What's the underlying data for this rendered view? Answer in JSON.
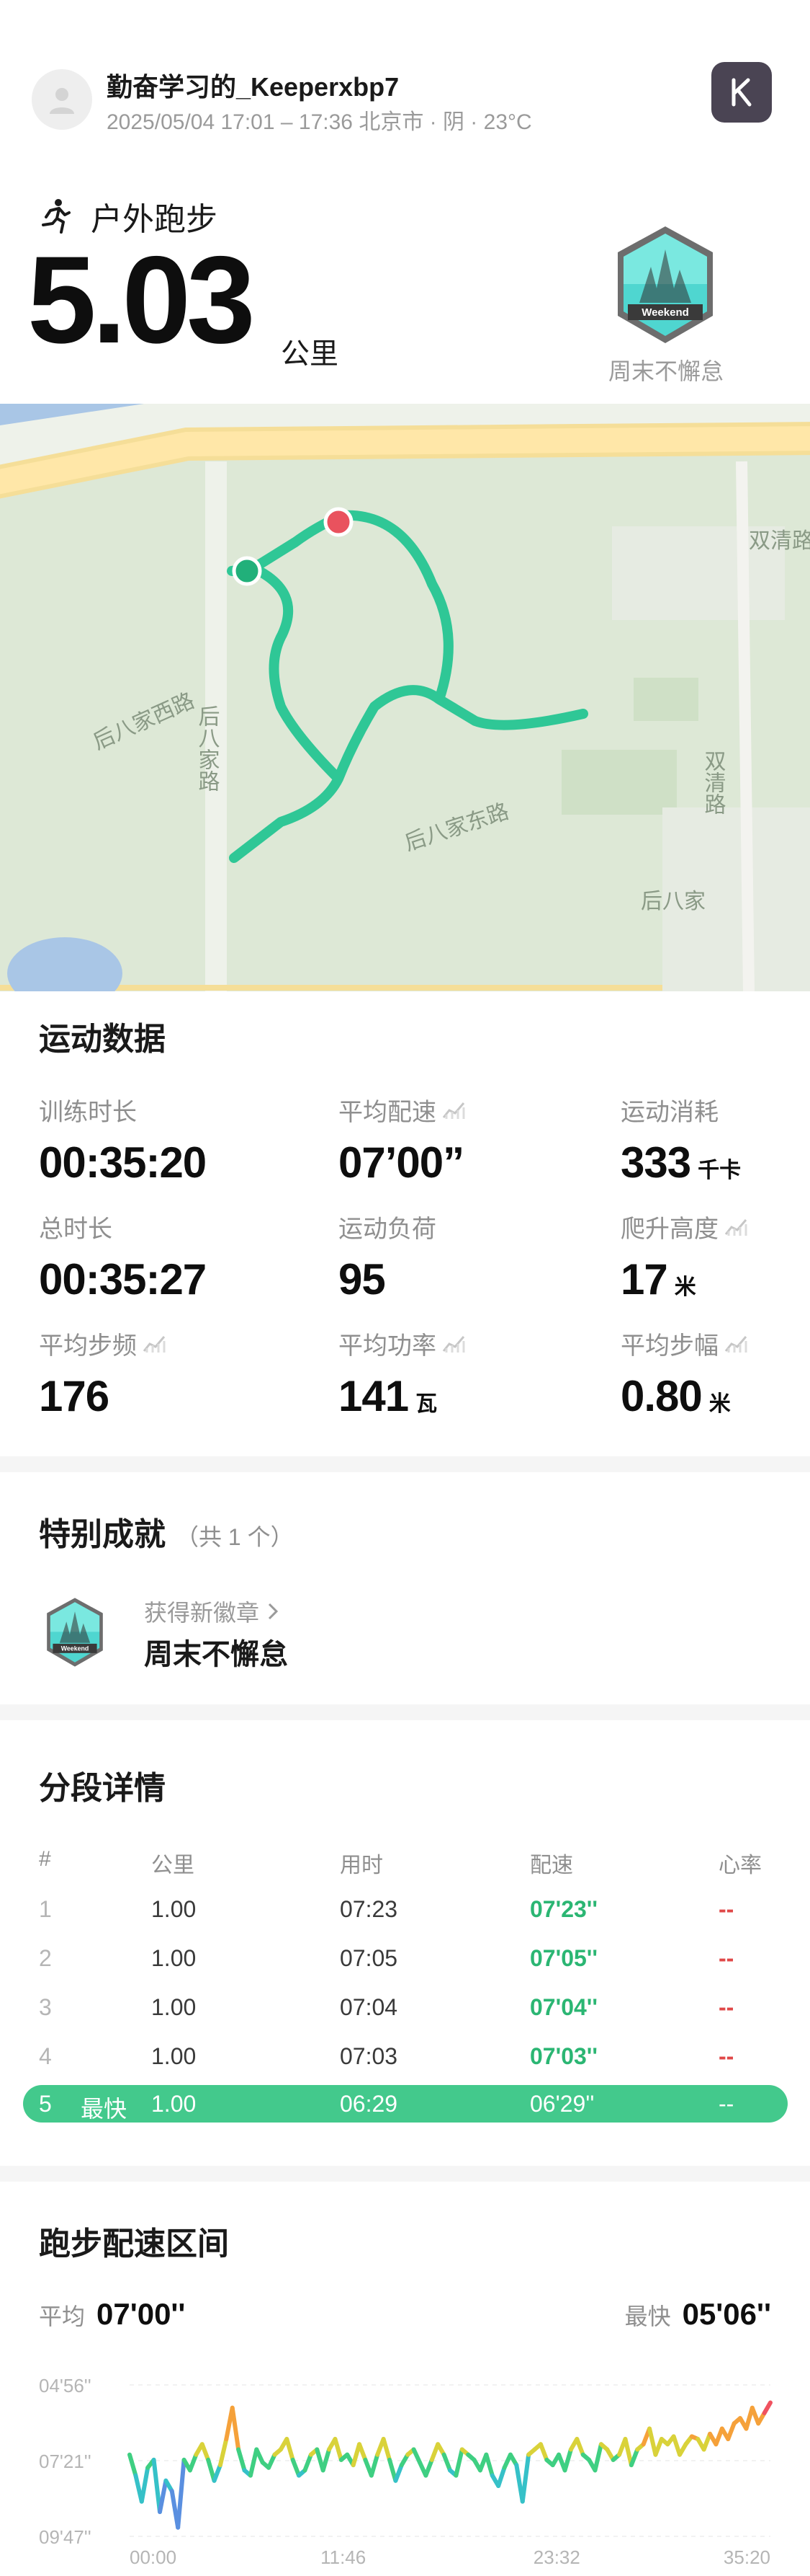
{
  "header": {
    "username": "勤奋学习的_Keeperxbp7",
    "meta": "2025/05/04 17:01 – 17:36 北京市 · 阴 · 23°C",
    "sport": "户外跑步",
    "distance": "5.03",
    "distance_unit": "公里",
    "badge_name": "周末不懈怠",
    "badge_text": "Weekend"
  },
  "map": {
    "labels": [
      "后八家西路",
      "后八家路",
      "后八家东路",
      "双清路",
      "双清路",
      "后八家"
    ]
  },
  "stats": {
    "title": "运动数据",
    "items": [
      {
        "label": "训练时长",
        "value": "00:35:20",
        "unit": ""
      },
      {
        "label": "平均配速",
        "value": "07’00”",
        "unit": ""
      },
      {
        "label": "运动消耗",
        "value": "333",
        "unit": "千卡"
      },
      {
        "label": "总时长",
        "value": "00:35:27",
        "unit": ""
      },
      {
        "label": "运动负荷",
        "value": "95",
        "unit": ""
      },
      {
        "label": "爬升高度",
        "value": "17",
        "unit": "米"
      },
      {
        "label": "平均步频",
        "value": "176",
        "unit": ""
      },
      {
        "label": "平均功率",
        "value": "141",
        "unit": "瓦"
      },
      {
        "label": "平均步幅",
        "value": "0.80",
        "unit": "米"
      }
    ]
  },
  "achievements": {
    "title": "特别成就",
    "count": "（共 1 个）",
    "new_label": "获得新徽章",
    "badge_name": "周末不懈怠",
    "badge_text": "Weekend"
  },
  "segments": {
    "title": "分段详情",
    "headers": [
      "#",
      "公里",
      "用时",
      "配速",
      "心率"
    ],
    "rows": [
      {
        "idx": "1",
        "km": "1.00",
        "time": "07:23",
        "pace": "07'23''",
        "hr": "--"
      },
      {
        "idx": "2",
        "km": "1.00",
        "time": "07:05",
        "pace": "07'05''",
        "hr": "--"
      },
      {
        "idx": "3",
        "km": "1.00",
        "time": "07:04",
        "pace": "07'04''",
        "hr": "--"
      },
      {
        "idx": "4",
        "km": "1.00",
        "time": "07:03",
        "pace": "07'03''",
        "hr": "--"
      }
    ],
    "fastest": {
      "idx": "5",
      "tag": "最快",
      "km": "1.00",
      "time": "06:29",
      "pace": "06'29''",
      "hr": "--"
    }
  },
  "pace_zone": {
    "title": "跑步配速区间",
    "avg_label": "平均",
    "avg_value": "07'00''",
    "fast_label": "最快",
    "fast_value": "05'06''"
  },
  "chart_data": {
    "type": "line",
    "y_ticks": [
      "04'56''",
      "07'21''",
      "09'47''"
    ],
    "x_ticks": [
      "00:00",
      "11:46",
      "23:32",
      "35:20"
    ],
    "ylim_seconds": [
      296,
      587
    ],
    "y_inverted": true,
    "x_seconds": [
      0,
      20,
      40,
      60,
      80,
      100,
      120,
      140,
      160,
      180,
      200,
      220,
      240,
      260,
      280,
      300,
      320,
      340,
      360,
      380,
      400,
      420,
      440,
      460,
      480,
      500,
      520,
      540,
      560,
      580,
      600,
      620,
      640,
      660,
      680,
      700,
      720,
      740,
      760,
      780,
      800,
      820,
      840,
      860,
      880,
      900,
      920,
      940,
      960,
      980,
      1000,
      1020,
      1040,
      1060,
      1080,
      1100,
      1120,
      1140,
      1160,
      1180,
      1200,
      1220,
      1240,
      1260,
      1280,
      1300,
      1320,
      1340,
      1360,
      1380,
      1400,
      1420,
      1440,
      1460,
      1480,
      1500,
      1520,
      1540,
      1560,
      1580,
      1600,
      1620,
      1640,
      1660,
      1680,
      1700,
      1720,
      1740,
      1760,
      1780,
      1800,
      1820,
      1840,
      1860,
      1880,
      1900,
      1920,
      1940,
      1960,
      1980,
      2000,
      2020,
      2040,
      2060,
      2080,
      2100,
      2120
    ],
    "pace_seconds": [
      430,
      470,
      520,
      455,
      440,
      540,
      480,
      500,
      570,
      440,
      460,
      430,
      410,
      440,
      480,
      450,
      400,
      340,
      420,
      460,
      470,
      420,
      445,
      455,
      430,
      420,
      400,
      440,
      470,
      460,
      430,
      420,
      460,
      420,
      400,
      440,
      430,
      450,
      410,
      440,
      470,
      430,
      400,
      440,
      480,
      450,
      430,
      420,
      445,
      470,
      440,
      410,
      430,
      460,
      470,
      420,
      430,
      440,
      460,
      430,
      470,
      490,
      455,
      430,
      450,
      520,
      430,
      420,
      410,
      440,
      450,
      430,
      460,
      420,
      400,
      430,
      440,
      460,
      410,
      420,
      440,
      430,
      400,
      450,
      420,
      410,
      380,
      430,
      400,
      410,
      395,
      430,
      410,
      395,
      400,
      420,
      390,
      410,
      380,
      400,
      370,
      360,
      380,
      340,
      370,
      350,
      330
    ]
  }
}
